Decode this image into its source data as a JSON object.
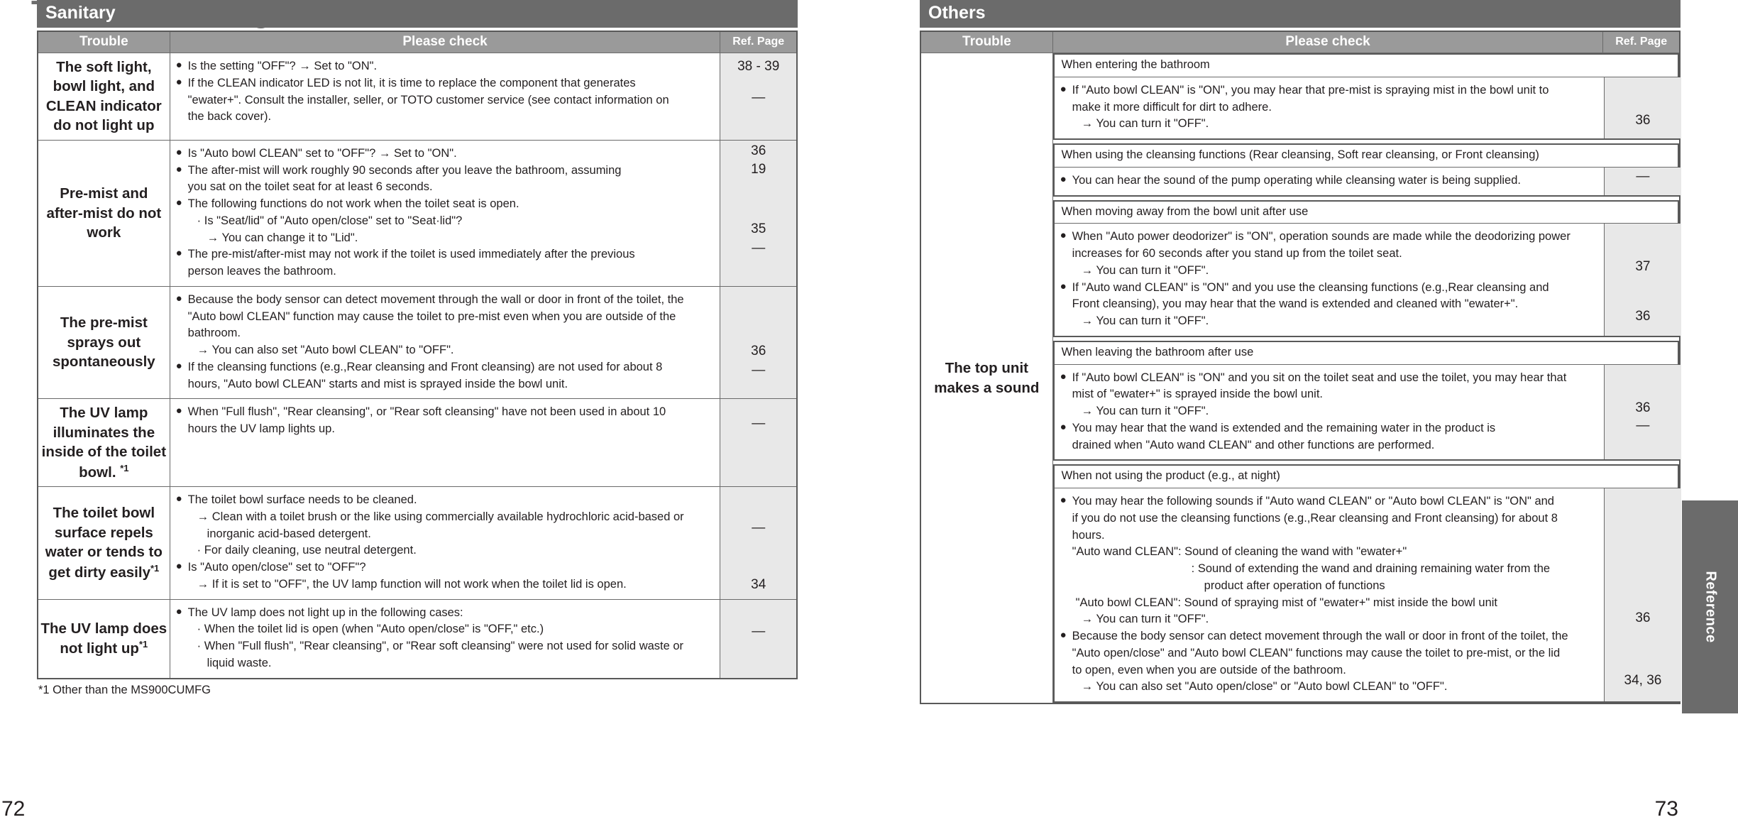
{
  "document": {
    "title": "Troubleshooting",
    "side_tab_label": "Reference",
    "folio_left": "72",
    "folio_right": "73",
    "footnote_left": "*1 Other than the MS900CUMFG"
  },
  "columns": {
    "trouble": "Trouble",
    "check": "Please check",
    "ref": "Ref. Page"
  },
  "sections": [
    {
      "name": "Sanitary",
      "rows": [
        {
          "trouble": "The soft light, bowl light, and CLEAN indicator do not light up",
          "lines": [
            {
              "kind": "bullet",
              "text": "Is the setting \"OFF\"? → Set to \"ON\"."
            },
            {
              "kind": "bullet",
              "text": "If the CLEAN indicator LED is not lit, it is time to replace the component that generates"
            },
            {
              "kind": "cont",
              "text": "\"ewater+\". Consult the installer, seller, or TOTO customer service (see contact information on"
            },
            {
              "kind": "cont",
              "text": "the back cover)."
            }
          ],
          "refs": [
            {
              "value": "38 - 39",
              "offset": 8
            },
            {
              "value": "—",
              "offset": 56
            }
          ]
        },
        {
          "trouble": "Pre-mist and after-mist do not work",
          "lines": [
            {
              "kind": "bullet",
              "text": "Is \"Auto bowl CLEAN\" set to \"OFF\"? → Set to \"ON\"."
            },
            {
              "kind": "bullet-just",
              "text": "The after-mist will work roughly 90 seconds after you leave the bathroom, assuming"
            },
            {
              "kind": "cont",
              "text": "you sat on the toilet seat for at least 6 seconds."
            },
            {
              "kind": "bullet",
              "text": "The following functions do not work when the toilet seat is open."
            },
            {
              "kind": "sub-dot",
              "text": "Is \"Seat/lid\" of \"Auto open/close\" set to \"Seat·lid\"?"
            },
            {
              "kind": "sub-arrow2",
              "text": "→ You can change it to \"Lid\"."
            },
            {
              "kind": "bullet-just",
              "text": "The pre-mist/after-mist may not work if the toilet is used immediately after the previous"
            },
            {
              "kind": "cont",
              "text": "person leaves the bathroom."
            }
          ],
          "refs": [
            {
              "value": "36",
              "offset": 4
            },
            {
              "value": "19",
              "offset": 32
            },
            {
              "value": "35",
              "offset": 125
            },
            {
              "value": "—",
              "offset": 155
            }
          ]
        },
        {
          "trouble": "The pre-mist sprays out spontaneously",
          "lines": [
            {
              "kind": "bullet",
              "text": "Because the body sensor can detect movement through the wall or door in front of the toilet, the"
            },
            {
              "kind": "cont",
              "text": "\"Auto bowl CLEAN\" function may cause the toilet to pre-mist even when you are outside of the"
            },
            {
              "kind": "cont",
              "text": "bathroom."
            },
            {
              "kind": "sub-arrow",
              "text": "→ You can also set \"Auto bowl CLEAN\" to \"OFF\"."
            },
            {
              "kind": "bullet",
              "text": "If the cleansing functions (e.g.,Rear cleansing and Front cleansing) are not used for about 8"
            },
            {
              "kind": "cont",
              "text": "hours, \"Auto bowl CLEAN\" starts and mist is sprayed inside the bowl unit."
            }
          ],
          "refs": [
            {
              "value": "36",
              "offset": 80
            },
            {
              "value": "—",
              "offset": 110
            }
          ]
        },
        {
          "trouble": "The UV lamp illuminates the inside of the toilet bowl. *1",
          "trouble_sup": "*1",
          "trouble_main": "The UV lamp illuminates the inside of the toilet bowl. ",
          "lines": [
            {
              "kind": "bullet",
              "text": "When \"Full flush\", \"Rear cleansing\", or \"Rear soft cleansing\" have not been used in about 10"
            },
            {
              "kind": "cont",
              "text": "hours the UV lamp lights up."
            }
          ],
          "refs": [
            {
              "value": "—",
              "offset": 24
            }
          ]
        },
        {
          "trouble_main": "The toilet bowl surface repels water or tends to get dirty easily",
          "trouble_sup": "*1",
          "lines": [
            {
              "kind": "bullet",
              "text": "The toilet bowl surface needs to be cleaned."
            },
            {
              "kind": "sub-arrow",
              "text": "→ Clean with a toilet brush or the like using commercially available hydrochloric acid-based or"
            },
            {
              "kind": "plain-i",
              "text": "inorganic acid-based detergent."
            },
            {
              "kind": "sub-dot",
              "text": "For daily cleaning, use neutral detergent."
            },
            {
              "kind": "bullet",
              "text": "Is \"Auto open/close\" set to \"OFF\"?"
            },
            {
              "kind": "sub-arrow",
              "text": "→ If it is set to \"OFF\", the UV lamp function will not work when the toilet lid is open."
            }
          ],
          "refs": [
            {
              "value": "—",
              "offset": 47
            },
            {
              "value": "34",
              "offset": 112
            }
          ]
        },
        {
          "trouble_main": "The UV lamp does not light up",
          "trouble_sup": "*1",
          "lines": [
            {
              "kind": "bullet",
              "text": "The UV lamp does not light up in the following cases:"
            },
            {
              "kind": "sub-dot",
              "text": "When the toilet lid is open (when \"Auto open/close\" is \"OFF,\" etc.)"
            },
            {
              "kind": "sub-dot",
              "text": "When \"Full flush\", \"Rear cleansing\", or \"Rear soft cleansing\" were not used for solid waste or"
            },
            {
              "kind": "plain-i",
              "text": "liquid waste."
            }
          ],
          "refs": [
            {
              "value": "—",
              "offset": 34
            }
          ]
        }
      ]
    },
    {
      "name": "Others",
      "trouble_label": "The top unit makes a sound",
      "groups": [
        {
          "header": "When entering the bathroom",
          "lines": [
            {
              "kind": "bullet",
              "text": "If \"Auto bowl CLEAN\" is \"ON\", you may hear that pre-mist is spraying mist in the bowl unit to"
            },
            {
              "kind": "cont",
              "text": "make it more difficult for dirt to adhere."
            },
            {
              "kind": "sub-arrow",
              "text": "→ You can turn it \"OFF\"."
            }
          ],
          "refs": [
            {
              "value": "36",
              "offset": 50
            }
          ]
        },
        {
          "header": "When using the cleansing functions (Rear cleansing, Soft rear cleansing, or Front cleansing)",
          "lines": [
            {
              "kind": "bullet",
              "text": "You can hear the sound of the pump operating while cleansing water is being supplied."
            }
          ],
          "refs": [
            {
              "value": "—",
              "offset": 2
            }
          ]
        },
        {
          "header": "When moving away from the bowl unit after use",
          "lines": [
            {
              "kind": "bullet",
              "text": "When \"Auto power deodorizer\" is \"ON\", operation sounds are made while the deodorizing power"
            },
            {
              "kind": "cont",
              "text": "increases for 60 seconds after you stand up from the toilet seat."
            },
            {
              "kind": "sub-arrow",
              "text": "→ You can turn it \"OFF\"."
            },
            {
              "kind": "bullet",
              "text": "If \"Auto wand CLEAN\" is \"ON\" and you use the cleansing functions (e.g.,Rear cleansing and"
            },
            {
              "kind": "cont",
              "text": "Front cleansing), you may hear that the wand is extended and cleaned with \"ewater+\"."
            },
            {
              "kind": "sub-arrow",
              "text": "→ You can turn it \"OFF\"."
            }
          ],
          "refs": [
            {
              "value": "37",
              "offset": 50
            },
            {
              "value": "36",
              "offset": 123
            }
          ]
        },
        {
          "header": "When leaving the bathroom after use",
          "lines": [
            {
              "kind": "bullet",
              "text": "If \"Auto bowl CLEAN\" is \"ON\" and you sit on the toilet seat and use the toilet, you may hear that"
            },
            {
              "kind": "cont",
              "text": "mist of \"ewater+\" is sprayed inside the bowl unit."
            },
            {
              "kind": "sub-arrow",
              "text": "→ You can turn it \"OFF\"."
            },
            {
              "kind": "bullet-just",
              "text": "You may hear that the wand is extended and the remaining water in the product is"
            },
            {
              "kind": "cont",
              "text": "drained when \"Auto wand CLEAN\" and other functions are performed."
            }
          ],
          "refs": [
            {
              "value": "36",
              "offset": 50
            },
            {
              "value": "—",
              "offset": 78
            }
          ]
        },
        {
          "header": "When not using the product (e.g., at night)",
          "lines": [
            {
              "kind": "bullet",
              "text": "You may hear the following sounds if \"Auto wand CLEAN\" or \"Auto bowl CLEAN\" is \"ON\" and"
            },
            {
              "kind": "cont",
              "text": "if you do not use the cleansing functions (e.g.,Rear cleansing and Front cleansing) for about 8"
            },
            {
              "kind": "cont",
              "text": "hours."
            },
            {
              "kind": "plain",
              "text": "\"Auto wand CLEAN\": Sound of cleaning the wand with \"ewater+\""
            },
            {
              "kind": "plain-ii",
              "text": ": Sound of extending the wand and draining remaining water from the"
            },
            {
              "kind": "plain-iii",
              "text": "product after operation of functions"
            },
            {
              "kind": "plain-pad",
              "text": "\"Auto bowl CLEAN\": Sound of spraying mist of \"ewater+\" mist inside the bowl unit"
            },
            {
              "kind": "sub-arrow",
              "text": "→ You can turn it \"OFF\"."
            },
            {
              "kind": "bullet",
              "text": "Because the body sensor can detect movement through the wall or door in front of the toilet, the"
            },
            {
              "kind": "cont",
              "text": "\"Auto open/close\" and \"Auto bowl CLEAN\" functions may cause the toilet to pre-mist, or the lid"
            },
            {
              "kind": "cont",
              "text": "to open, even when you are outside of the bathroom."
            },
            {
              "kind": "sub-arrow",
              "text": "→ You can also set \"Auto open/close\" or \"Auto bowl CLEAN\" to \"OFF\"."
            }
          ],
          "refs": [
            {
              "value": "36",
              "offset": 172
            },
            {
              "value": "34, 36",
              "offset": 262
            }
          ]
        }
      ]
    }
  ]
}
